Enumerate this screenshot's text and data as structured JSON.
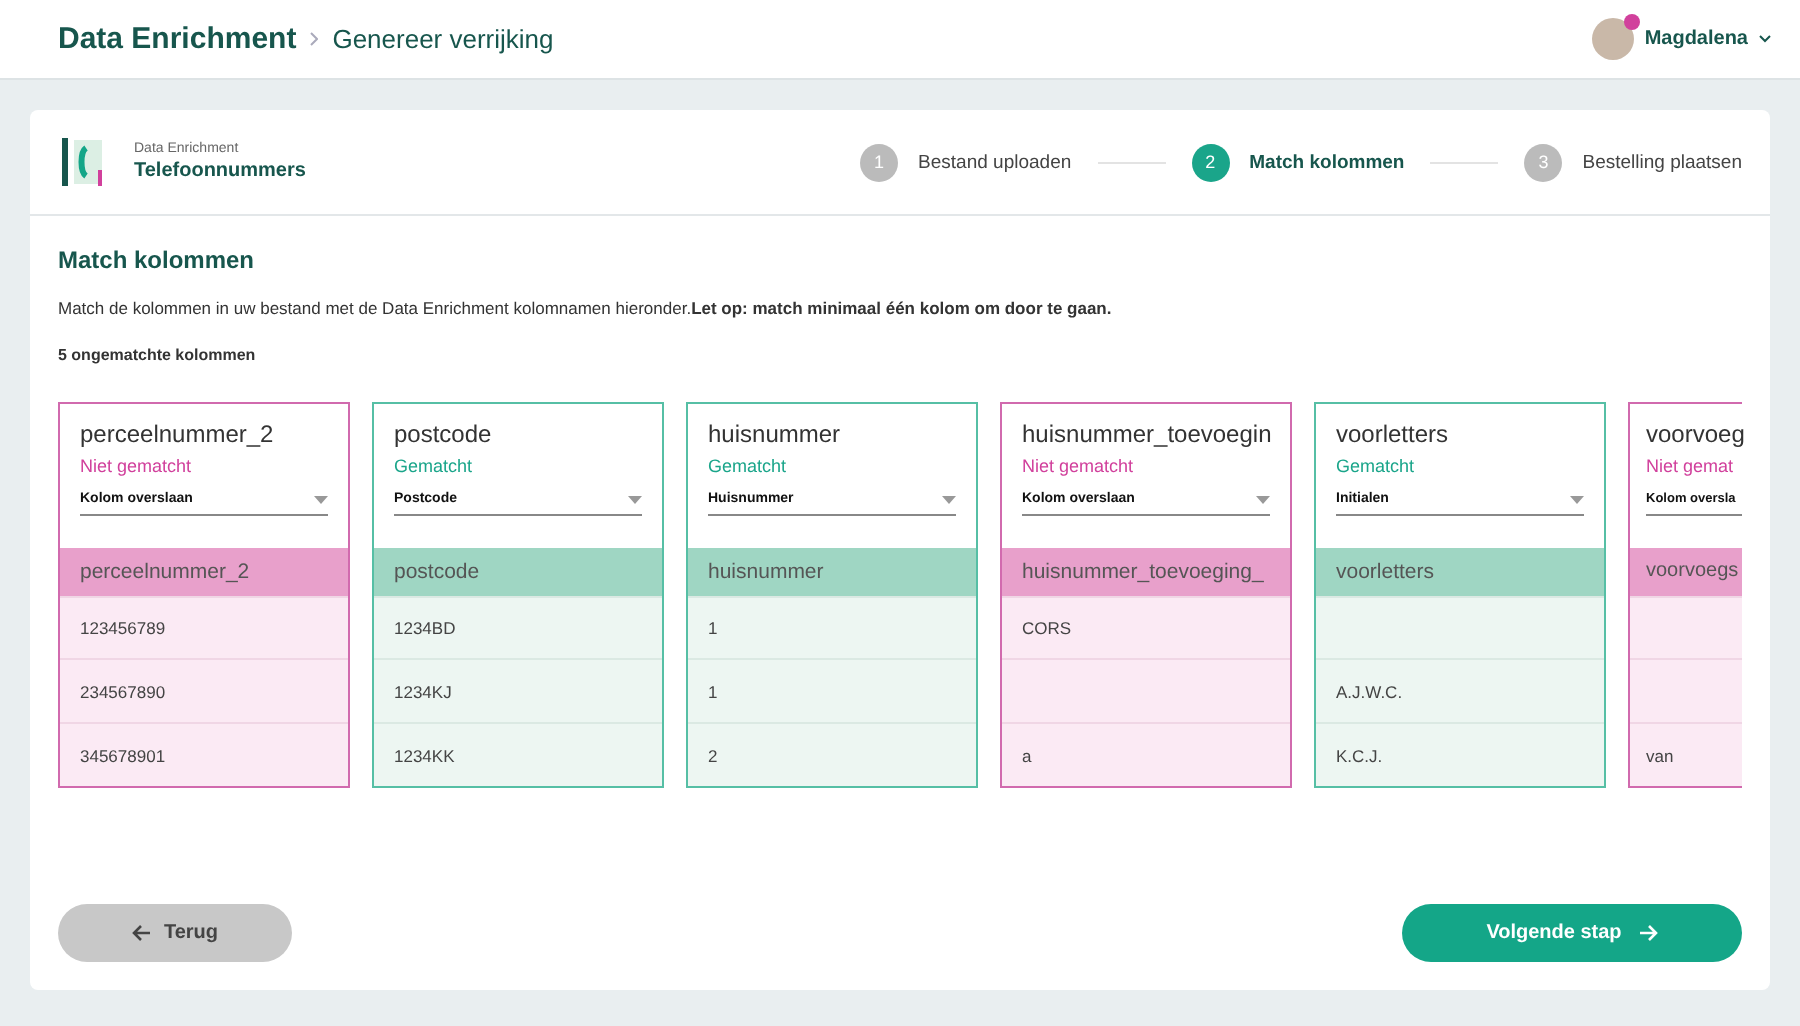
{
  "header": {
    "title": "Data Enrichment",
    "breadcrumb": "Genereer verrijking",
    "user": "Magdalena",
    "notification": true
  },
  "product": {
    "category": "Data Enrichment",
    "name": "Telefoonnummers"
  },
  "steps": [
    {
      "number": "1",
      "label": "Bestand uploaden",
      "selected": false
    },
    {
      "number": "2",
      "label": "Match kolommen",
      "selected": true
    },
    {
      "number": "3",
      "label": "Bestelling plaatsen",
      "selected": false
    }
  ],
  "section": {
    "title": "Match kolommen",
    "description": "Match de kolommen in uw bestand met de Data Enrichment kolomnamen hieronder.**Let op: match minimaal één kolom om door te gaan.**",
    "count": "5 ongematchte kolommen"
  },
  "columns": [
    {
      "name": "perceelnummer_2",
      "status": "Niet gematcht",
      "matched": false,
      "mapping": "Kolom overslaan",
      "source": "perceelnummer_2",
      "cells": [
        {
          "text": "123456789"
        },
        {
          "text": "234567890"
        },
        {
          "text": "345678901"
        }
      ]
    },
    {
      "name": "postcode",
      "status": "Gematcht",
      "matched": true,
      "mapping": "Postcode",
      "source": "postcode",
      "cells": [
        {
          "text": "1234BD"
        },
        {
          "text": "1234KJ"
        },
        {
          "text": "1234KK"
        }
      ]
    },
    {
      "name": "huisnummer",
      "status": "Gematcht",
      "matched": true,
      "mapping": "Huisnummer",
      "source": "huisnummer",
      "cells": [
        {
          "text": "1"
        },
        {
          "text": "1"
        },
        {
          "text": "2"
        }
      ]
    },
    {
      "name": "huisnummer_toevoegin",
      "status": "Niet gematcht",
      "matched": false,
      "mapping": "Kolom overslaan",
      "source": "huisnummer_toevoeging_",
      "cells": [
        {
          "text": "CORS"
        },
        {},
        {
          "text": "a"
        }
      ]
    },
    {
      "name": "voorletters",
      "status": "Gematcht",
      "matched": true,
      "mapping": "Initialen",
      "source": "voorletters",
      "cells": [
        {},
        {
          "text": "A.J.W.C."
        },
        {
          "text": "K.C.J."
        }
      ]
    },
    {
      "name": "voorvoeg",
      "status": "Niet gemat",
      "matched": false,
      "mapping": "Kolom oversla",
      "source": "voorvoegs",
      "cells": [
        {},
        {},
        {
          "text": "van"
        }
      ]
    }
  ],
  "buttons": {
    "back": "Terug",
    "next": "Volgende stap"
  }
}
